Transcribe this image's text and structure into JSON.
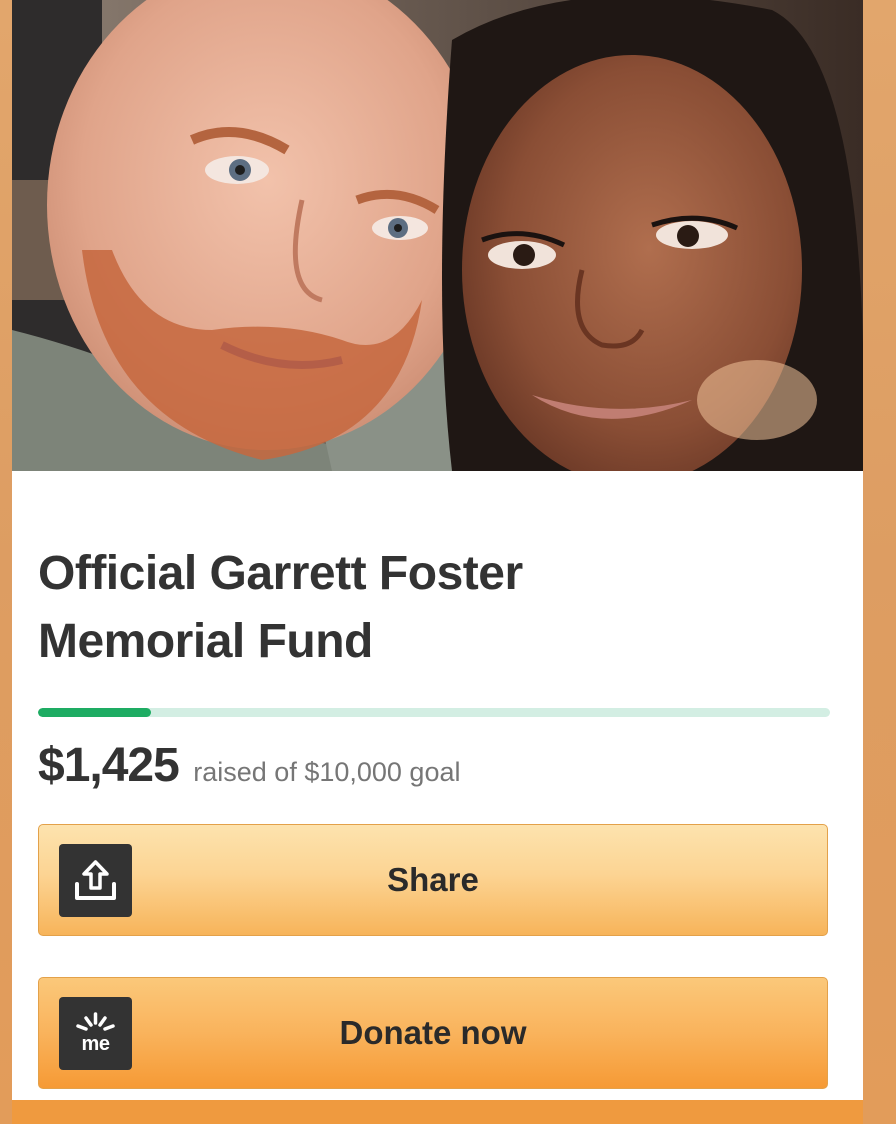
{
  "campaign": {
    "title_line1": "Official Garrett Foster",
    "title_line2": "Memorial Fund",
    "amount_raised": "$1,425",
    "goal_text": "raised of $10,000 goal",
    "progress_fraction": 0.1425
  },
  "buttons": {
    "share_label": "Share",
    "share_icon": "share-upload-icon",
    "donate_label": "Donate now",
    "donate_icon": "gofundme-logo-icon",
    "donate_icon_text": "me"
  },
  "colors": {
    "progress_fill": "#1eac63",
    "progress_track": "#d3eee3",
    "title_text": "#333333"
  }
}
